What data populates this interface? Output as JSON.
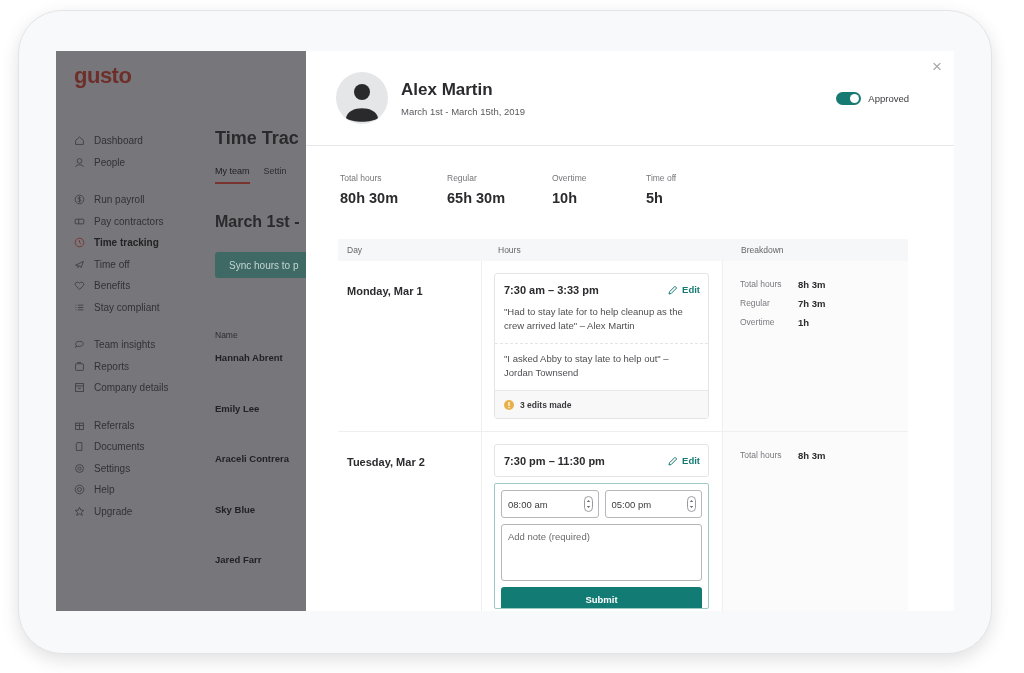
{
  "background_app": {
    "logo": "gusto",
    "sidebar": {
      "groups": [
        [
          {
            "label": "Dashboard",
            "selected": false
          },
          {
            "label": "People",
            "selected": false
          }
        ],
        [
          {
            "label": "Run payroll",
            "selected": false
          },
          {
            "label": "Pay contractors",
            "selected": false
          },
          {
            "label": "Time tracking",
            "selected": true
          },
          {
            "label": "Time off",
            "selected": false
          },
          {
            "label": "Benefits",
            "selected": false
          },
          {
            "label": "Stay compliant",
            "selected": false
          }
        ],
        [
          {
            "label": "Team insights",
            "selected": false
          },
          {
            "label": "Reports",
            "selected": false
          },
          {
            "label": "Company details",
            "selected": false
          }
        ],
        [
          {
            "label": "Referrals",
            "selected": false
          },
          {
            "label": "Documents",
            "selected": false
          },
          {
            "label": "Settings",
            "selected": false
          },
          {
            "label": "Help",
            "selected": false
          },
          {
            "label": "Upgrade",
            "selected": false
          }
        ]
      ]
    },
    "main": {
      "title": "Time Trac",
      "tabs": [
        {
          "label": "My team",
          "selected": true
        },
        {
          "label": "Settin",
          "selected": false
        }
      ],
      "period": "March 1st -",
      "sync_button": "Sync hours to p",
      "table": {
        "columns": [
          "Name"
        ],
        "rows": [
          "Hannah Abrent",
          "Emily Lee",
          "Araceli Contrera",
          "Sky Blue",
          "Jared Farr"
        ]
      }
    }
  },
  "drawer": {
    "close": "×",
    "employee": {
      "name": "Alex Martin",
      "period": "March 1st - March 15th, 2019"
    },
    "approval": {
      "label": "Approved",
      "on": true
    },
    "summary": [
      {
        "label": "Total hours",
        "value": "80h 30m"
      },
      {
        "label": "Regular",
        "value": "65h 30m"
      },
      {
        "label": "Overtime",
        "value": "10h"
      },
      {
        "label": "Time off",
        "value": "5h"
      }
    ],
    "timesheet": {
      "columns": [
        "Day",
        "Hours",
        "Breakdown"
      ],
      "days": [
        {
          "day": "Monday, Mar 1",
          "kind": "entry",
          "shift": {
            "time": "7:30 am – 3:33 pm",
            "edit": "Edit",
            "notes": [
              "\"Had to stay late for to help cleanup as the crew arrived late\" – Alex Martin",
              "\"I asked Abby to stay late to help out\" – Jordan Townsend"
            ],
            "edits": "3 edits made"
          },
          "breakdown": [
            {
              "label": "Total hours",
              "value": "8h 3m"
            },
            {
              "label": "Regular",
              "value": "7h 3m"
            },
            {
              "label": "Overtime",
              "value": "1h"
            }
          ]
        },
        {
          "day": "Tuesday, Mar 2",
          "kind": "editing",
          "shift": {
            "time": "7:30 pm – 11:30 pm",
            "edit": "Edit"
          },
          "form": {
            "start": "08:00 am",
            "end": "05:00 pm",
            "note_placeholder": "Add note (required)",
            "submit": "Submit"
          },
          "breakdown": [
            {
              "label": "Total hours",
              "value": "8h 3m"
            }
          ]
        }
      ]
    }
  }
}
